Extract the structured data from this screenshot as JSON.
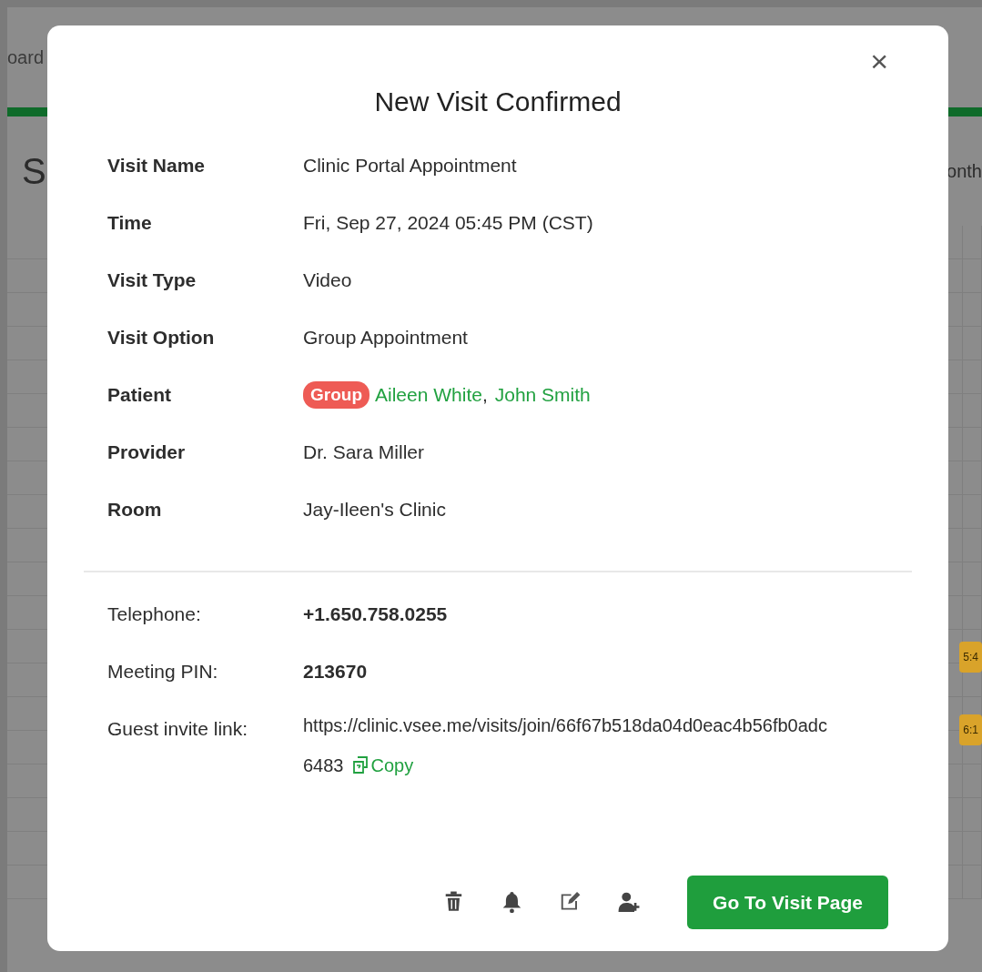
{
  "background": {
    "nav_fragment": "oard",
    "heading_fragment": "S",
    "view_fragment": "onth",
    "events": [
      {
        "label": "5:4",
        "color": "#d9a32a"
      },
      {
        "label": "6:1",
        "color": "#d9a32a"
      }
    ]
  },
  "modal": {
    "close": "×",
    "title": "New Visit Confirmed",
    "details": [
      {
        "label": "Visit Name",
        "value": "Clinic Portal Appointment"
      },
      {
        "label": "Time",
        "value": "Fri, Sep 27, 2024 05:45 PM (CST)"
      },
      {
        "label": "Visit Type",
        "value": "Video"
      },
      {
        "label": "Visit Option",
        "value": "Group Appointment"
      },
      {
        "label": "Patient",
        "kind": "patients",
        "badge": "Group",
        "patients": [
          "Aileen White",
          "John Smith"
        ],
        "separator": ","
      },
      {
        "label": "Provider",
        "value": "Dr. Sara Miller"
      },
      {
        "label": "Room",
        "value": "Jay-Ileen's Clinic"
      }
    ],
    "meeting": [
      {
        "label": "Telephone:",
        "value": "+1.650.758.0255"
      },
      {
        "label": "Meeting PIN:",
        "value": "213670"
      },
      {
        "label": "Guest invite link:",
        "kind": "link",
        "value": "https://clinic.vsee.me/visits/join/66f67b518da04d0eac4b56fb0adc6483",
        "copy": "Copy"
      }
    ],
    "actions": [
      {
        "kind": "delete"
      },
      {
        "kind": "notify"
      },
      {
        "kind": "edit"
      },
      {
        "kind": "add-guest"
      }
    ],
    "primary_button": "Go To Visit Page"
  }
}
